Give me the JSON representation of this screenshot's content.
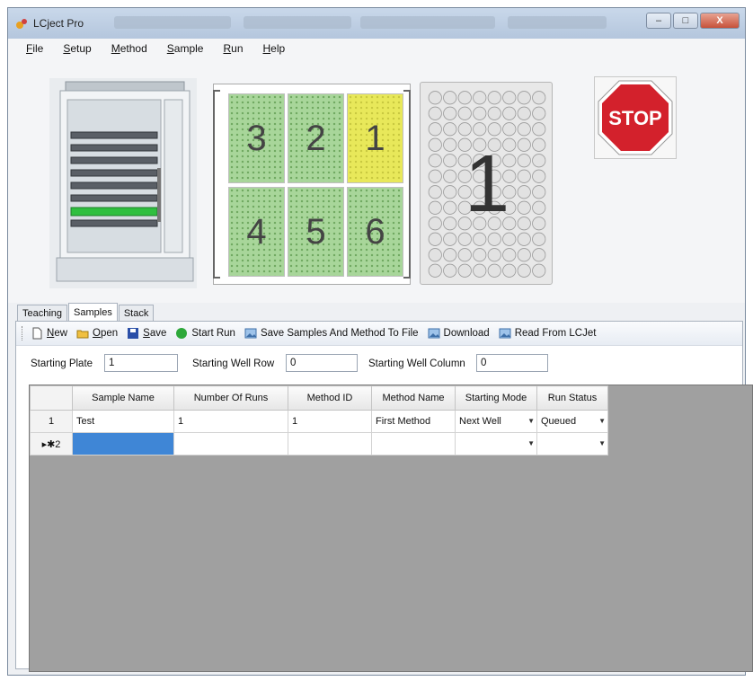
{
  "window": {
    "title": "LCject Pro",
    "controls": {
      "minimize": "–",
      "maximize": "□",
      "close": "X"
    }
  },
  "menu": [
    "File",
    "Setup",
    "Method",
    "Sample",
    "Run",
    "Help"
  ],
  "plates": {
    "labels": [
      "3",
      "2",
      "1",
      "4",
      "5",
      "6"
    ],
    "active_label": "1",
    "colors": {
      "loaded": "#a8d69a",
      "active": "#e8e85a"
    }
  },
  "wellplate": {
    "current": "1"
  },
  "stop": {
    "label": "STOP",
    "color": "#d3212c"
  },
  "tabs": [
    {
      "label": "Teaching",
      "active": false
    },
    {
      "label": "Samples",
      "active": true
    },
    {
      "label": "Stack",
      "active": false
    }
  ],
  "toolbar": {
    "new": "New",
    "open": "Open",
    "save": "Save",
    "start_run": "Start Run",
    "save_samples": "Save Samples And Method To File",
    "download": "Download",
    "read": "Read From LCJet"
  },
  "fields": {
    "starting_plate": {
      "label": "Starting Plate",
      "value": "1"
    },
    "starting_well_row": {
      "label": "Starting Well Row",
      "value": "0"
    },
    "starting_well_column": {
      "label": "Starting Well Column",
      "value": "0"
    }
  },
  "grid": {
    "columns": [
      "Sample Name",
      "Number Of Runs",
      "Method ID",
      "Method Name",
      "Starting Mode",
      "Run Status"
    ],
    "rows": [
      {
        "header": "1",
        "cells": [
          "Test",
          "1",
          "1",
          "First Method",
          "Next Well",
          "Queued"
        ]
      },
      {
        "header": "▸✱2",
        "cells": [
          "",
          "",
          "",
          "",
          "",
          ""
        ]
      }
    ]
  }
}
